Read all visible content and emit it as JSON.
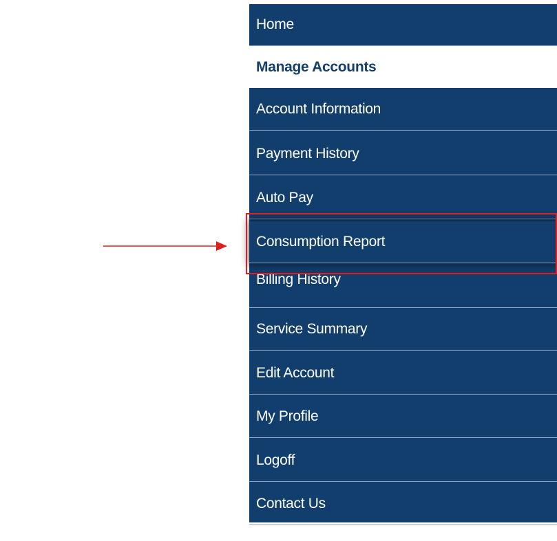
{
  "menu": {
    "items": [
      {
        "label": "Home"
      },
      {
        "label": "Manage Accounts",
        "active": true
      },
      {
        "label": "Account Information"
      },
      {
        "label": "Payment History"
      },
      {
        "label": "Auto Pay"
      },
      {
        "label": "Consumption Report",
        "highlighted": true
      },
      {
        "label": "Billing History"
      },
      {
        "label": "Service Summary"
      },
      {
        "label": "Edit Account"
      },
      {
        "label": "My Profile"
      },
      {
        "label": "Logoff"
      },
      {
        "label": "Contact Us"
      }
    ]
  },
  "colors": {
    "menu_background": "#123e6e",
    "active_text": "#163e6b",
    "annotation_red": "#e01f1f"
  }
}
